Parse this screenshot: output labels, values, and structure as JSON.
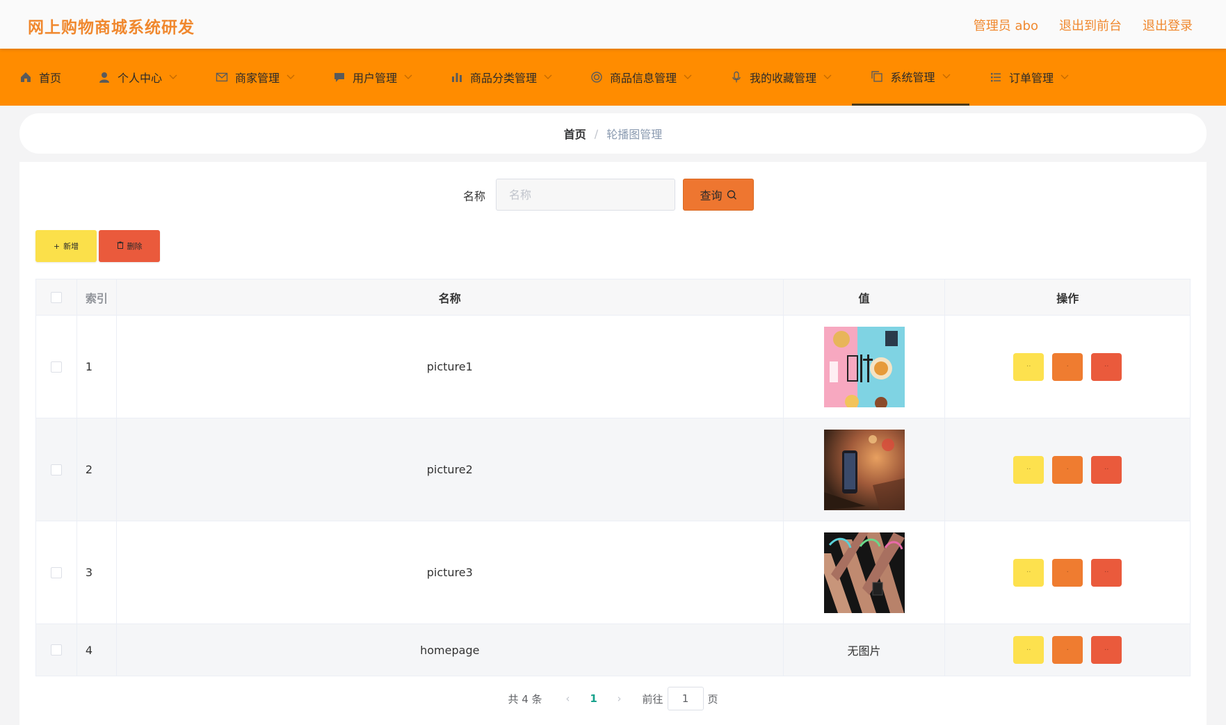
{
  "header": {
    "app_title": "网上购物商城系统研发",
    "links": [
      "管理员 abo",
      "退出到前台",
      "退出登录"
    ]
  },
  "nav": {
    "items": [
      {
        "label": "首页",
        "icon": "home-icon",
        "has_chevron": false
      },
      {
        "label": "个人中心",
        "icon": "user-icon",
        "has_chevron": true
      },
      {
        "label": "商家管理",
        "icon": "mail-icon",
        "has_chevron": true
      },
      {
        "label": "用户管理",
        "icon": "chat-icon",
        "has_chevron": true
      },
      {
        "label": "商品分类管理",
        "icon": "bar-chart-icon",
        "has_chevron": true
      },
      {
        "label": "商品信息管理",
        "icon": "target-icon",
        "has_chevron": true
      },
      {
        "label": "我的收藏管理",
        "icon": "microphone-icon",
        "has_chevron": true
      },
      {
        "label": "系统管理",
        "icon": "copy-icon",
        "has_chevron": true,
        "active": true
      },
      {
        "label": "订单管理",
        "icon": "list-icon",
        "has_chevron": true
      }
    ]
  },
  "breadcrumb": {
    "home": "首页",
    "separator": "/",
    "current": "轮播图管理"
  },
  "search": {
    "label": "名称",
    "placeholder": "名称",
    "value": "",
    "button_label": "查询"
  },
  "actions": {
    "add_label": "新增",
    "delete_label": "删除"
  },
  "table": {
    "columns": [
      "",
      "索引",
      "名称",
      "值",
      "操作"
    ],
    "rows": [
      {
        "index": "1",
        "name": "picture1",
        "value_type": "image",
        "value_text": ""
      },
      {
        "index": "2",
        "name": "picture2",
        "value_type": "image",
        "value_text": ""
      },
      {
        "index": "3",
        "name": "picture3",
        "value_type": "image",
        "value_text": ""
      },
      {
        "index": "4",
        "name": "homepage",
        "value_type": "text",
        "value_text": "无图片"
      }
    ]
  },
  "pagination": {
    "total_text": "共 4 条",
    "current_page": "1",
    "goto_label": "前往",
    "goto_value": "1",
    "page_suffix": "页"
  },
  "colors": {
    "brand_orange": "#ff8c00",
    "title_orange": "#f0882e",
    "button_yellow": "#fde14e",
    "button_orange": "#ef7c30",
    "button_red": "#ea5a3c",
    "page_active": "#16a28c"
  }
}
